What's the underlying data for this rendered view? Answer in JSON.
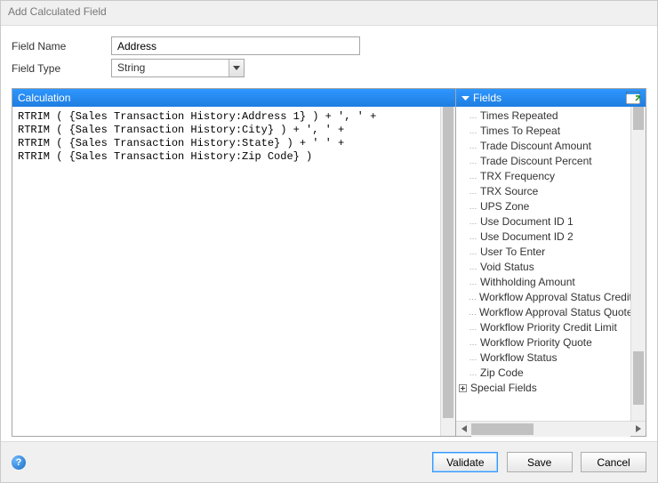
{
  "window": {
    "title": "Add Calculated Field"
  },
  "form": {
    "field_name_label": "Field Name",
    "field_name_value": "Address",
    "field_type_label": "Field Type",
    "field_type_value": "String"
  },
  "calc": {
    "header": "Calculation",
    "text": "RTRIM ( {Sales Transaction History:Address 1} ) + ', ' +\nRTRIM ( {Sales Transaction History:City} ) + ', ' +\nRTRIM ( {Sales Transaction History:State} ) + ' ' +\nRTRIM ( {Sales Transaction History:Zip Code} )"
  },
  "fields": {
    "header": "Fields",
    "items": [
      "Times Repeated",
      "Times To Repeat",
      "Trade Discount Amount",
      "Trade Discount Percent",
      "TRX Frequency",
      "TRX Source",
      "UPS Zone",
      "Use Document ID 1",
      "Use Document ID 2",
      "User To Enter",
      "Void Status",
      "Withholding Amount",
      "Workflow Approval Status Credit Limit",
      "Workflow Approval Status Quote",
      "Workflow Priority Credit Limit",
      "Workflow Priority Quote",
      "Workflow Status",
      "Zip Code"
    ],
    "parent": "Special Fields"
  },
  "buttons": {
    "validate": "Validate",
    "save": "Save",
    "cancel": "Cancel"
  },
  "help": "?"
}
